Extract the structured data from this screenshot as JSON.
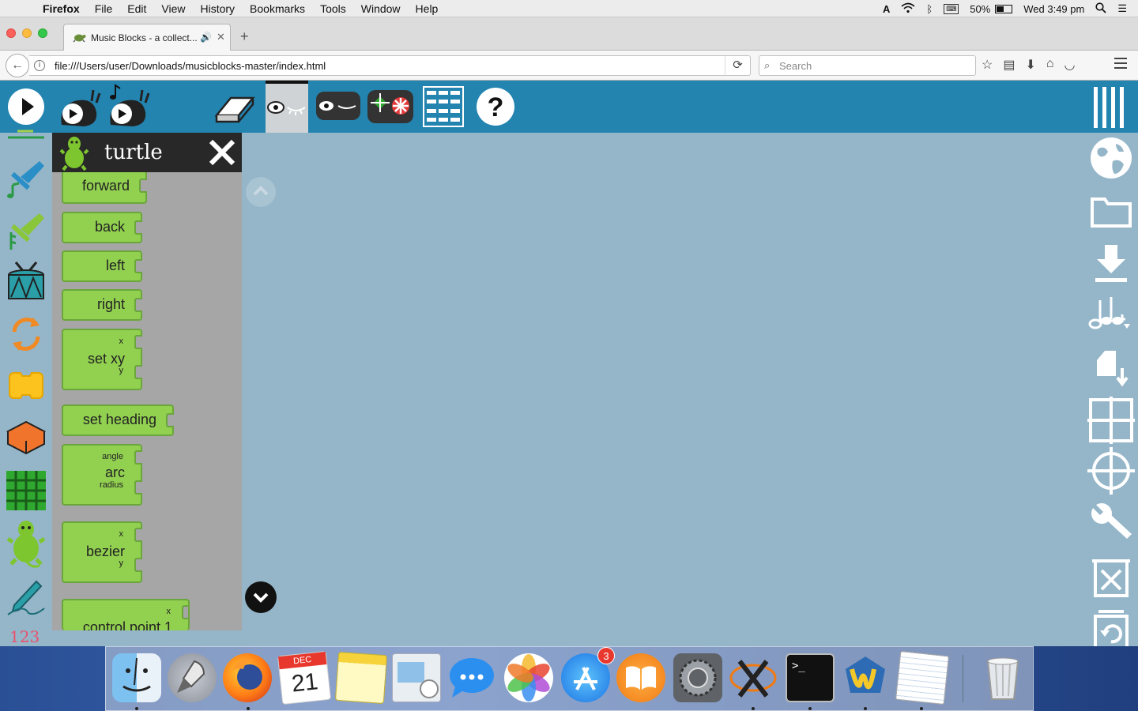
{
  "menubar": {
    "app_name": "Firefox",
    "items": [
      "File",
      "Edit",
      "View",
      "History",
      "Bookmarks",
      "Tools",
      "Window",
      "Help"
    ],
    "battery": "50%",
    "clock": "Wed 3:49 pm"
  },
  "browser": {
    "tab_title": "Music Blocks - a collect...",
    "url": "file:///Users/user/Downloads/musicblocks-master/index.html",
    "search_placeholder": "Search"
  },
  "toolbar": {
    "icons": [
      "play-icon",
      "run-slow-icon",
      "run-step-icon",
      "eraser-icon",
      "hide-blocks-icon",
      "collapse-blocks-icon",
      "home-icon",
      "grid-icon",
      "help-icon",
      "main-menu-icon"
    ]
  },
  "palettes": [
    "rhythm",
    "meter",
    "drum",
    "flow",
    "action",
    "boxes",
    "widgets",
    "turtle",
    "pen",
    "number"
  ],
  "palette_number_label": "123",
  "flyout": {
    "title": "turtle",
    "blocks": {
      "forward": "forward",
      "back": "back",
      "left": "left",
      "right": "right",
      "setxy": "set xy",
      "setxy_x": "x",
      "setxy_y": "y",
      "setheading": "set heading",
      "arc": "arc",
      "arc_angle": "angle",
      "arc_radius": "radius",
      "bezier": "bezier",
      "bezier_x": "x",
      "bezier_y": "y",
      "controlpoint": "control point 1",
      "controlpoint_x": "x"
    }
  },
  "right_toolbar": {
    "icons": [
      "planet-icon",
      "open-folder-icon",
      "save-icon",
      "save-music-icon",
      "export-icon",
      "cartesian-grid-icon",
      "polar-grid-icon",
      "settings-wrench-icon",
      "clear-icon",
      "restore-trash-icon"
    ]
  },
  "dock": {
    "apps": [
      "Finder",
      "Launchpad",
      "Firefox",
      "Calendar",
      "Notes",
      "Preview",
      "Messages",
      "Photos",
      "App Store",
      "iBooks",
      "System Preferences",
      "XQuartz",
      "Terminal",
      "Wolfram",
      "TextEdit",
      "Trash"
    ],
    "calendar_month": "DEC",
    "calendar_day": "21",
    "appstore_badge": "3"
  }
}
